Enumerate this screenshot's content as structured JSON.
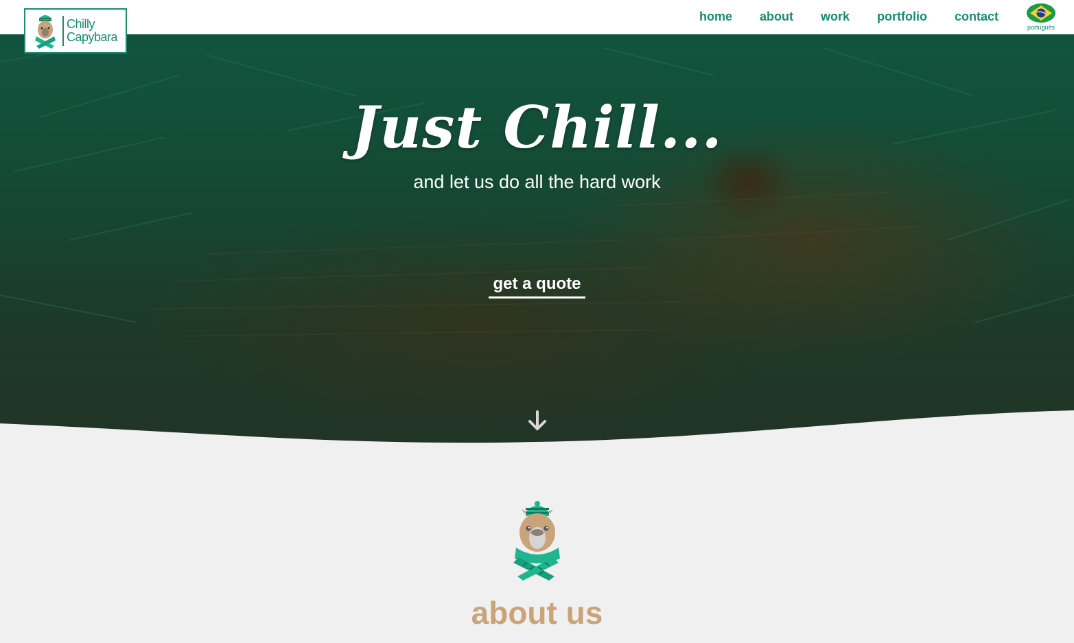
{
  "brand": {
    "name_line1": "Chilly",
    "name_line2": "Capybara",
    "logo_icon": "capybara-with-scarf-icon",
    "color_primary": "#1a8a73"
  },
  "nav": {
    "items": [
      {
        "label": "home"
      },
      {
        "label": "about"
      },
      {
        "label": "work"
      },
      {
        "label": "portfolio"
      },
      {
        "label": "contact"
      }
    ],
    "language": {
      "label": "português",
      "icon": "brazil-flag-icon"
    }
  },
  "hero": {
    "title": "Just Chill...",
    "subtitle": "and let us do all the hard work",
    "cta_label": "get a quote",
    "scroll_icon": "arrow-down-icon"
  },
  "about": {
    "title": "about us",
    "title_color": "#c9a37a",
    "mascot_icon": "capybara-with-scarf-icon"
  }
}
